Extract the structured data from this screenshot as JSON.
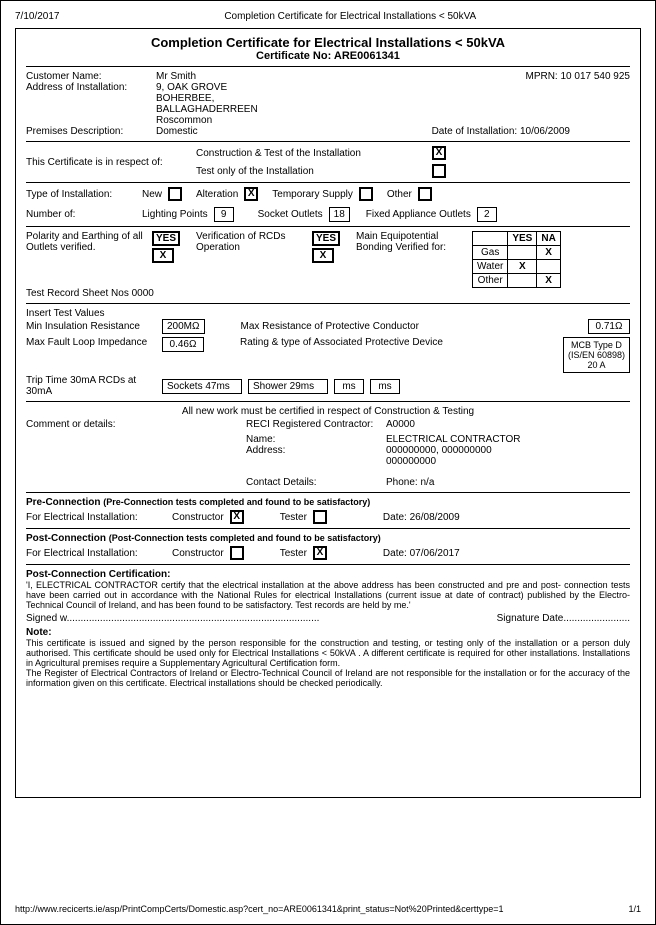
{
  "header": {
    "date": "7/10/2017",
    "page_title": "Completion Certificate for Electrical Installations < 50kVA"
  },
  "cert": {
    "title": "Completion Certificate for Electrical Installations < 50kVA",
    "cert_no_label": "Certificate No: ARE0061341",
    "customer_name_label": "Customer Name:",
    "customer_name": "Mr  Smith",
    "mprn_label": "MPRN: 10 017 540 925",
    "addr_label": "Address of Installation:",
    "addr_line1": "9, OAK GROVE",
    "addr_line2": "BOHERBEE,",
    "addr_line3": "BALLAGHADERREEN",
    "addr_line4": "Roscommon",
    "premises_label": "Premises Description:",
    "premises": "Domestic",
    "doi_label": "Date of Installation: 10/06/2009",
    "respect_label": "This Certificate is in respect of:",
    "respect_opt1": "Construction & Test of the Installation",
    "respect_opt2": "Test only of the Installation",
    "respect_chk1": "X",
    "respect_chk2": "",
    "type_label": "Type of Installation:",
    "type_new": "New",
    "type_new_chk": "",
    "type_alt": "Alteration",
    "type_alt_chk": "X",
    "type_temp": "Temporary Supply",
    "type_temp_chk": "",
    "type_other": "Other",
    "type_other_chk": "",
    "numof_label": "Number of:",
    "lp_label": "Lighting Points",
    "lp_val": "9",
    "so_label": "Socket Outlets",
    "so_val": "18",
    "fao_label": "Fixed Appliance Outlets",
    "fao_val": "2",
    "polarity_label": "Polarity and Earthing of all Outlets verified.",
    "pol_yes": "YES",
    "pol_x": "X",
    "rcd_label": "Verification of RCDs Operation",
    "rcd_yes": "YES",
    "rcd_x": "X",
    "mbond_label": "Main Equipotential Bonding Verified for:",
    "yn_yes": "YES",
    "yn_na": "NA",
    "gas": "Gas",
    "gas_yes": "",
    "gas_na": "X",
    "water": "Water",
    "water_yes": "X",
    "water_na": "",
    "other": "Other",
    "other_yes": "",
    "other_na": "X",
    "trs_label": "Test Record Sheet Nos 0000",
    "itv_label": "Insert Test Values",
    "min_ins_label": "Min Insulation Resistance",
    "min_ins_val": "200MΩ",
    "max_res_label": "Max Resistance of Protective Conductor",
    "max_res_val": "0.71Ω",
    "mfli_label": "Max Fault Loop Impedance",
    "mfli_val": "0.46Ω",
    "rating_label": "Rating & type of Associated Protective Device",
    "rating_val1": "MCB Type D",
    "rating_val2": "(IS/EN 60898)",
    "rating_val3": "20 A",
    "trip_label": "Trip Time 30mA RCDs at 30mA",
    "trip_v1": "Sockets 47ms",
    "trip_v2": "Shower  29ms",
    "trip_v3": "ms",
    "trip_v4": "ms",
    "allnew": "All new work must be certified in respect of Construction & Testing",
    "comment_label": "Comment or details:",
    "reci_reg": "RECI Registered Contractor:",
    "reci_val": "A0000",
    "name_label": "Name:",
    "name_val": "ELECTRICAL CONTRACTOR",
    "addrc_label": "Address:",
    "addrc_val1": "000000000, 000000000",
    "addrc_val2": "000000000",
    "contact_label": "Contact Details:",
    "contact_val": "Phone: n/a",
    "precon_label": "Pre-Connection",
    "precon_text": "(Pre-Connection tests completed and found to be satisfactory)",
    "fei_label": "For Electrical Installation:",
    "constructor": "Constructor",
    "tester": "Tester",
    "precon_c": "X",
    "precon_t": "",
    "precon_date": "Date: 26/08/2009",
    "postcon_label": "Post-Connection",
    "postcon_text": "(Post-Connection tests completed and found to be satisfactory)",
    "postcon_c": "",
    "postcon_t": "X",
    "postcon_date": "Date: 07/06/2017",
    "pcc_label": "Post-Connection Certification:",
    "pcc_text": "'I, ELECTRICAL CONTRACTOR certify that the electrical installation at the above address has been constructed and pre and post- connection tests have been carried out in accordance with the National Rules for electrical Installations (current issue at date of contract) published by the Electro-Technical Council of Ireland, and has been found to be satisfactory. Test records are held by me.'",
    "signed": "Signed w...........................................................................................",
    "sigdate": "Signature Date........................",
    "note_label": "Note:",
    "note_text": "This certificate is issued and signed by the person responsible for the construction and testing, or testing only of the installation or a person duly authorised. This certificate should be used only for Electrical Installations < 50kVA . A different certificate is required for other installations. Installations in Agricultural premises require a Supplementary Agricultural Certification form.\nThe Register of Electrical Contractors of Ireland or Electro-Technical Council of Ireland are not responsible for the installation or for the accuracy of the information given on this certificate. Electrical installations should be checked periodically."
  },
  "footer": {
    "url": "http://www.recicerts.ie/asp/PrintCompCerts/Domestic.asp?cert_no=ARE0061341&print_status=Not%20Printed&certtype=1",
    "pages": "1/1"
  }
}
